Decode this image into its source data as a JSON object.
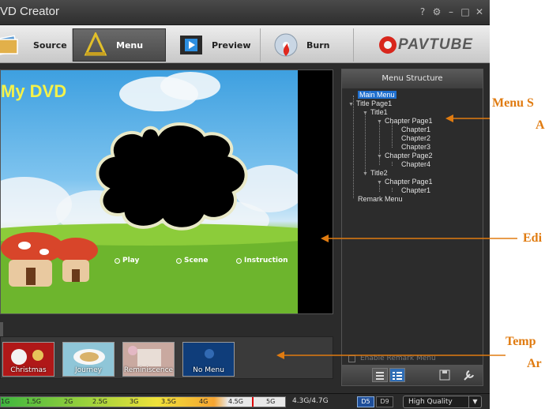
{
  "window": {
    "title": "VD Creator"
  },
  "window_controls": [
    "help-icon",
    "settings-icon",
    "minimize-icon",
    "maximize-icon",
    "close-icon"
  ],
  "toolbar": {
    "tabs": [
      {
        "label": "Source",
        "icon": "source-photos-icon",
        "active": false
      },
      {
        "label": "Menu",
        "icon": "menu-ruler-icon",
        "active": true
      },
      {
        "label": "Preview",
        "icon": "preview-film-icon",
        "active": false
      },
      {
        "label": "Burn",
        "icon": "burn-disc-icon",
        "active": false
      }
    ],
    "brand": "PAVTUBE"
  },
  "preview": {
    "dvd_title": "My DVD",
    "buttons": [
      "Play",
      "Scene",
      "Instruction"
    ]
  },
  "templates": [
    {
      "label": "Christmas",
      "color": "#b01818"
    },
    {
      "label": "Journey",
      "color": "#8fc6d8"
    },
    {
      "label": "Reminiscence",
      "color": "#c9a9a0"
    },
    {
      "label": "No Menu",
      "color": "#0f3d7a"
    }
  ],
  "menu_structure": {
    "heading": "Menu Structure",
    "items": [
      {
        "label": "Main Menu",
        "selected": true
      },
      {
        "label": "Title Page1"
      },
      {
        "label": "Title1"
      },
      {
        "label": "Chapter Page1"
      },
      {
        "label": "Chapter1"
      },
      {
        "label": "Chapter2"
      },
      {
        "label": "Chapter3"
      },
      {
        "label": "Chapter Page2"
      },
      {
        "label": "Chapter4"
      },
      {
        "label": "Title2"
      },
      {
        "label": "Chapter Page1"
      },
      {
        "label": "Chapter1"
      },
      {
        "label": "Remark Menu"
      }
    ],
    "enable_remark_label": "Enable Remark Menu"
  },
  "status": {
    "ticks": [
      "1G",
      "1.5G",
      "2G",
      "2.5G",
      "3G",
      "3.5G",
      "4G",
      "4.5G",
      "5G"
    ],
    "capacity_text": "4.3G/4.7G",
    "disc_types": [
      "D5",
      "D9"
    ],
    "quality": "High Quality"
  },
  "callouts": [
    "Menu S",
    "A",
    "Edi",
    "Temp",
    "Ar"
  ],
  "colors": {
    "accent": "#e07b10",
    "selection": "#1f6fce"
  }
}
